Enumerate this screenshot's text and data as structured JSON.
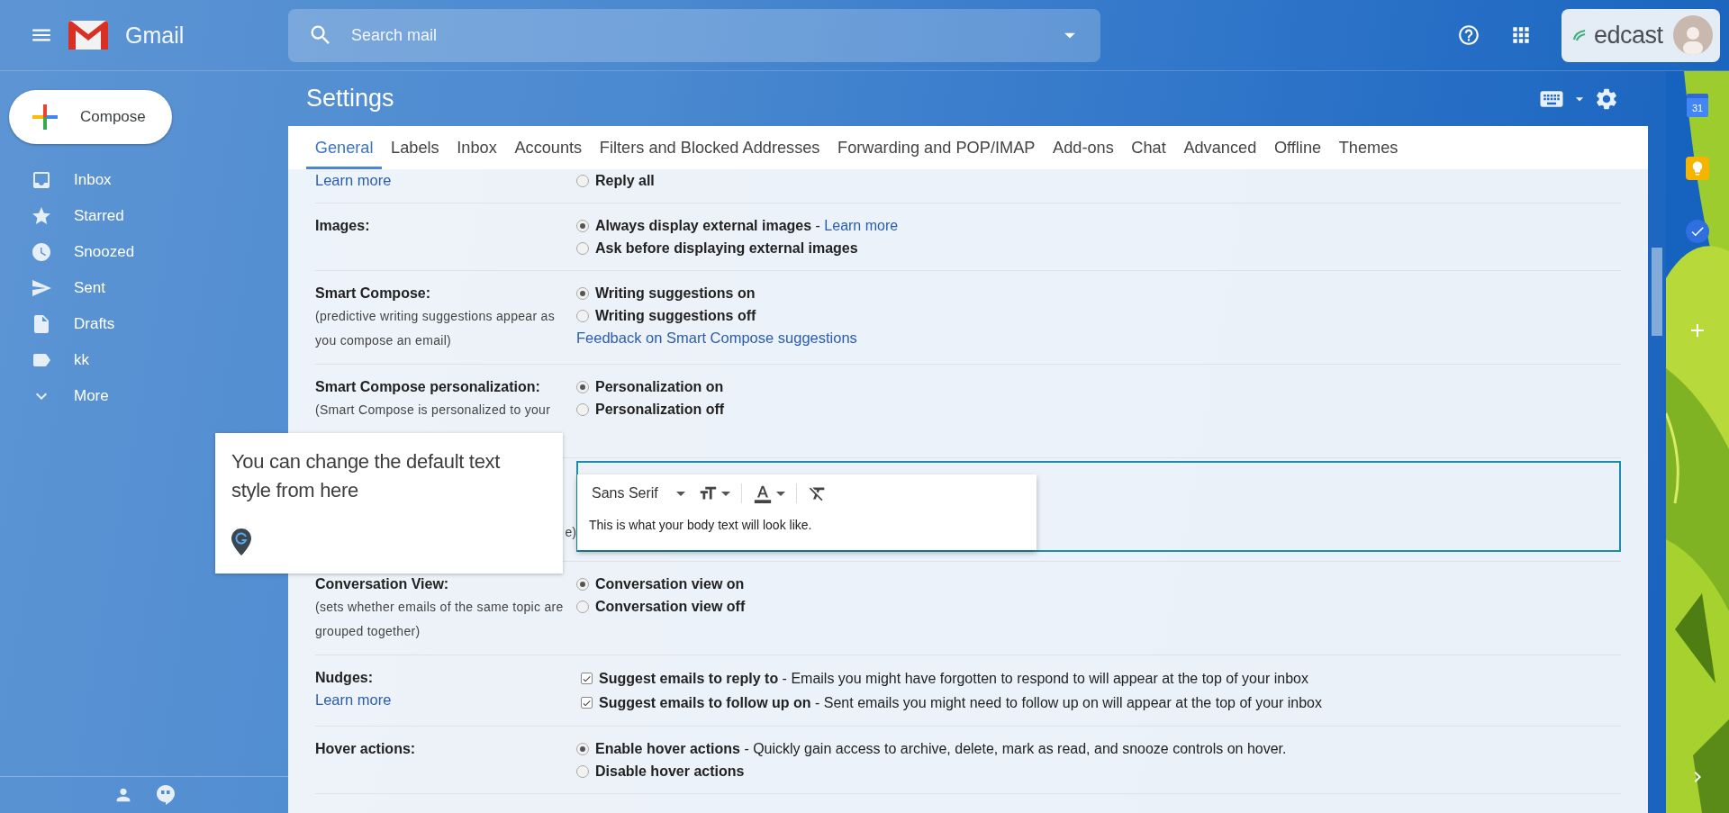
{
  "header": {
    "app_name": "Gmail",
    "search_placeholder": "Search mail",
    "account_brand": "edcast"
  },
  "sidebar": {
    "compose": "Compose",
    "items": [
      {
        "label": "Inbox",
        "kind": "inbox",
        "selected": false
      },
      {
        "label": "Starred",
        "kind": "star",
        "selected": false
      },
      {
        "label": "Snoozed",
        "kind": "clock",
        "selected": false
      },
      {
        "label": "Sent",
        "kind": "send",
        "selected": false
      },
      {
        "label": "Drafts",
        "kind": "file",
        "selected": false
      },
      {
        "label": "kk",
        "kind": "tag",
        "selected": false
      },
      {
        "label": "More",
        "kind": "chevron",
        "selected": false
      }
    ]
  },
  "settings": {
    "title": "Settings",
    "tabs": [
      {
        "label": "General",
        "selected": true
      },
      {
        "label": "Labels",
        "selected": false
      },
      {
        "label": "Inbox",
        "selected": false
      },
      {
        "label": "Accounts",
        "selected": false
      },
      {
        "label": "Filters and Blocked Addresses",
        "selected": false
      },
      {
        "label": "Forwarding and POP/IMAP",
        "selected": false
      },
      {
        "label": "Add-ons",
        "selected": false
      },
      {
        "label": "Chat",
        "selected": false
      },
      {
        "label": "Advanced",
        "selected": false
      },
      {
        "label": "Offline",
        "selected": false
      },
      {
        "label": "Themes",
        "selected": false
      }
    ],
    "rows": [
      {
        "kind": "options",
        "label_link": "Learn more",
        "options": [
          {
            "kind": "radio",
            "label": "Reply all",
            "selected": false
          }
        ]
      },
      {
        "kind": "options",
        "label": "Images:",
        "options": [
          {
            "kind": "radio",
            "label": "Always display external images",
            "detail": " - ",
            "link": "Learn more",
            "selected": true
          },
          {
            "kind": "radio",
            "label": "Ask before displaying external images",
            "selected": false
          }
        ]
      },
      {
        "kind": "options",
        "label": "Smart Compose:",
        "description": "(predictive writing suggestions appear as you compose an email)",
        "options": [
          {
            "kind": "radio",
            "label": "Writing suggestions on",
            "selected": true
          },
          {
            "kind": "radio",
            "label": "Writing suggestions off",
            "selected": false
          },
          {
            "kind": "link",
            "link": "Feedback on Smart Compose suggestions"
          }
        ]
      },
      {
        "kind": "options",
        "label": "Smart Compose personalization:",
        "description": "(Smart Compose is personalized to your",
        "options": [
          {
            "kind": "radio",
            "label": "Personalization on",
            "selected": true
          },
          {
            "kind": "radio",
            "label": "Personalization off",
            "selected": false
          }
        ]
      },
      {
        "kind": "text_style",
        "label_tail": "e)",
        "preview": {
          "font": "Sans Serif",
          "sample": "This is what your body text will look like."
        }
      },
      {
        "kind": "options",
        "label": "Conversation View:",
        "description": "(sets whether emails of the same topic are grouped together)",
        "options": [
          {
            "kind": "radio",
            "label": "Conversation view on",
            "selected": true
          },
          {
            "kind": "radio",
            "label": "Conversation view off",
            "selected": false
          }
        ]
      },
      {
        "kind": "options",
        "label": "Nudges:",
        "label_link": "Learn more",
        "options": [
          {
            "kind": "checkbox",
            "label": "Suggest emails to reply to",
            "detail": " - Emails you might have forgotten to respond to will appear at the top of your inbox",
            "checked": true
          },
          {
            "kind": "checkbox",
            "label": "Suggest emails to follow up on",
            "detail": " - Sent emails you might need to follow up on will appear at the top of your inbox",
            "checked": true
          }
        ]
      },
      {
        "kind": "options",
        "label": "Hover actions:",
        "options": [
          {
            "kind": "radio",
            "label": "Enable hover actions",
            "detail": " - Quickly gain access to archive, delete, mark as read, and snooze controls on hover.",
            "selected": true
          },
          {
            "kind": "radio",
            "label": "Disable hover actions",
            "selected": false
          }
        ]
      }
    ]
  },
  "tooltip": {
    "text": "You can change the default text style from here"
  },
  "side_panel": {
    "apps": [
      {
        "kind": "calendar",
        "text": "31"
      },
      {
        "kind": "keep"
      },
      {
        "kind": "tasks"
      },
      {
        "kind": "add"
      }
    ]
  }
}
